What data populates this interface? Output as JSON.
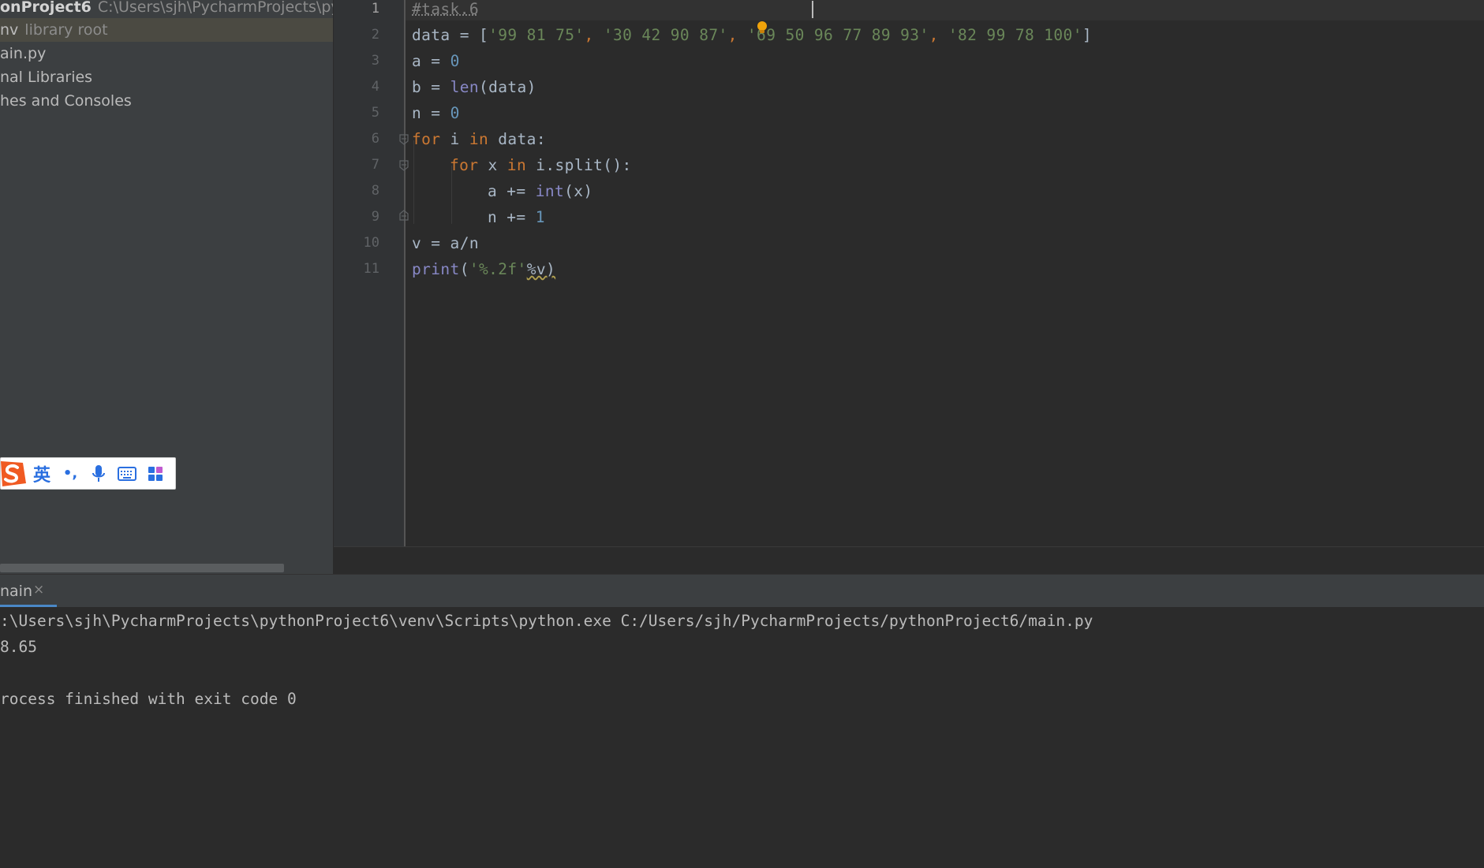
{
  "project_panel": {
    "root_name": "onProject6",
    "root_path": "C:\\Users\\sjh\\PycharmProjects\\pythonP",
    "venv_name": "nv",
    "venv_hint": "library root",
    "main_file": "ain.py",
    "external_libraries": "nal Libraries",
    "scratches": "hes and Consoles"
  },
  "ime_toolbar": {
    "lang_label": "英",
    "punct_label": "•,"
  },
  "editor": {
    "current_line": 1,
    "line_numbers": [
      "1",
      "2",
      "3",
      "4",
      "5",
      "6",
      "7",
      "8",
      "9",
      "10",
      "11"
    ]
  },
  "code": {
    "l1_comment": "#task.6",
    "l2_var": "data = [",
    "l2_s1": "'99 81 75'",
    "l2_c1": ", ",
    "l2_s2": "'30 42 90 87'",
    "l2_c2": ", ",
    "l2_s3": "'69 50 96 77 89 93'",
    "l2_c3": ", ",
    "l2_s4": "'82 99 78 100'",
    "l2_end": "]",
    "l3_var": "a = ",
    "l3_num": "0",
    "l4_var": "b = ",
    "l4_fn": "len",
    "l4_rest": "(data)",
    "l5_var": "n = ",
    "l5_num": "0",
    "l6_kw1": "for",
    "l6_mid": " i ",
    "l6_kw2": "in",
    "l6_rest": " data:",
    "l7_kw1": "for",
    "l7_mid": " x ",
    "l7_kw2": "in",
    "l7_rest": " i.split():",
    "l8_var": "a += ",
    "l8_fn": "int",
    "l8_rest": "(x)",
    "l9_var": "n += ",
    "l9_num": "1",
    "l10": "v = a/n",
    "l11_fn": "print",
    "l11_open": "(",
    "l11_str": "'%.2f'",
    "l11_rest": "%v)"
  },
  "run_panel": {
    "tab_label": "nain",
    "close_glyph": "×",
    "command": ":\\Users\\sjh\\PycharmProjects\\pythonProject6\\venv\\Scripts\\python.exe C:/Users/sjh/PycharmProjects/pythonProject6/main.py",
    "output": "8.65",
    "exit_message": "rocess finished with exit code 0"
  }
}
